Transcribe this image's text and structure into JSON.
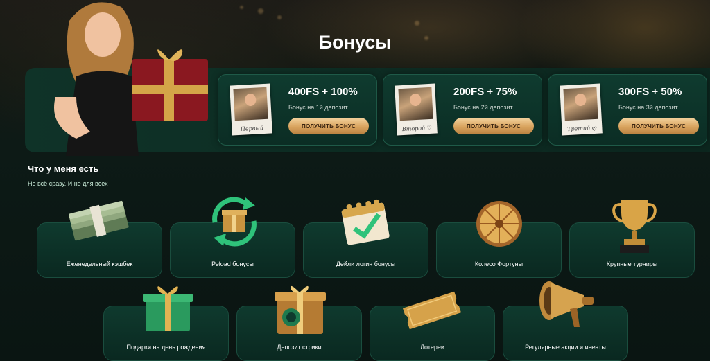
{
  "page": {
    "title": "Бонусы"
  },
  "offers": [
    {
      "amount": "400FS + 100%",
      "description": "Бонус на 1й депозит",
      "button": "ПОЛУЧИТЬ БОНУС",
      "caption": "Первый"
    },
    {
      "amount": "200FS + 75%",
      "description": "Бонус на 2й депозит",
      "button": "ПОЛУЧИТЬ БОНУС",
      "caption": "Второй ♡"
    },
    {
      "amount": "300FS + 50%",
      "description": "Бонус на 3й депозит",
      "button": "ПОЛУЧИТЬ БОНУС",
      "caption": "Третий ღ"
    }
  ],
  "section": {
    "title": "Что у меня есть",
    "subtitle": "Не всё сразу. И не для всех"
  },
  "features": [
    {
      "label": "Еженедельный кэшбек",
      "icon": "money-stack-icon"
    },
    {
      "label": "Реload бонусы",
      "icon": "gift-reload-icon"
    },
    {
      "label": "Дейли логин бонусы",
      "icon": "calendar-check-icon"
    },
    {
      "label": "Колесо Фортуны",
      "icon": "fortune-wheel-icon"
    },
    {
      "label": "Крупные турниры",
      "icon": "trophy-icon"
    },
    {
      "label": "Подарки на день рождения",
      "icon": "gift-box-icon"
    },
    {
      "label": "Депозит стрики",
      "icon": "deposit-gift-icon"
    },
    {
      "label": "Лотереи",
      "icon": "ticket-icon"
    },
    {
      "label": "Регулярные акции и ивенты",
      "icon": "megaphone-icon"
    }
  ],
  "colors": {
    "accent_gold": "#d9a35e",
    "card_green": "#0f3a2e",
    "background": "#0b1613"
  }
}
